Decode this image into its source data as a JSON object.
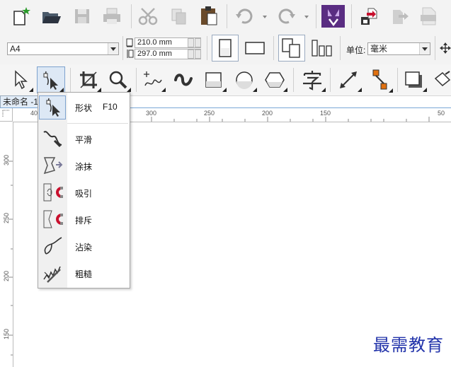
{
  "document": {
    "tab_label": "未命名 -1"
  },
  "page_settings": {
    "page_size": "A4",
    "width": "210.0 mm",
    "height": "297.0 mm",
    "units_label": "单位:",
    "units_value": "毫米"
  },
  "flyout": {
    "items": [
      {
        "label": "形状",
        "shortcut": "F10",
        "icon": "shape-tool-icon",
        "selected": true
      },
      {
        "label": "平滑",
        "icon": "smooth-tool-icon"
      },
      {
        "label": "涂抹",
        "icon": "smear-tool-icon"
      },
      {
        "label": "吸引",
        "icon": "attract-tool-icon"
      },
      {
        "label": "排斥",
        "icon": "repel-tool-icon"
      },
      {
        "label": "沾染",
        "icon": "smudge-tool-icon"
      },
      {
        "label": "粗糙",
        "icon": "roughen-tool-icon"
      }
    ]
  },
  "ruler": {
    "h_ticks": [
      "40",
      "300",
      "250",
      "200",
      "150",
      "50"
    ],
    "v_ticks": [
      "300",
      "250",
      "200",
      "150"
    ]
  },
  "watermark": "最需教育",
  "colors": {
    "accent": "#5a2d82",
    "red": "#c8102e",
    "ruler_line": "#7aa7d6"
  }
}
